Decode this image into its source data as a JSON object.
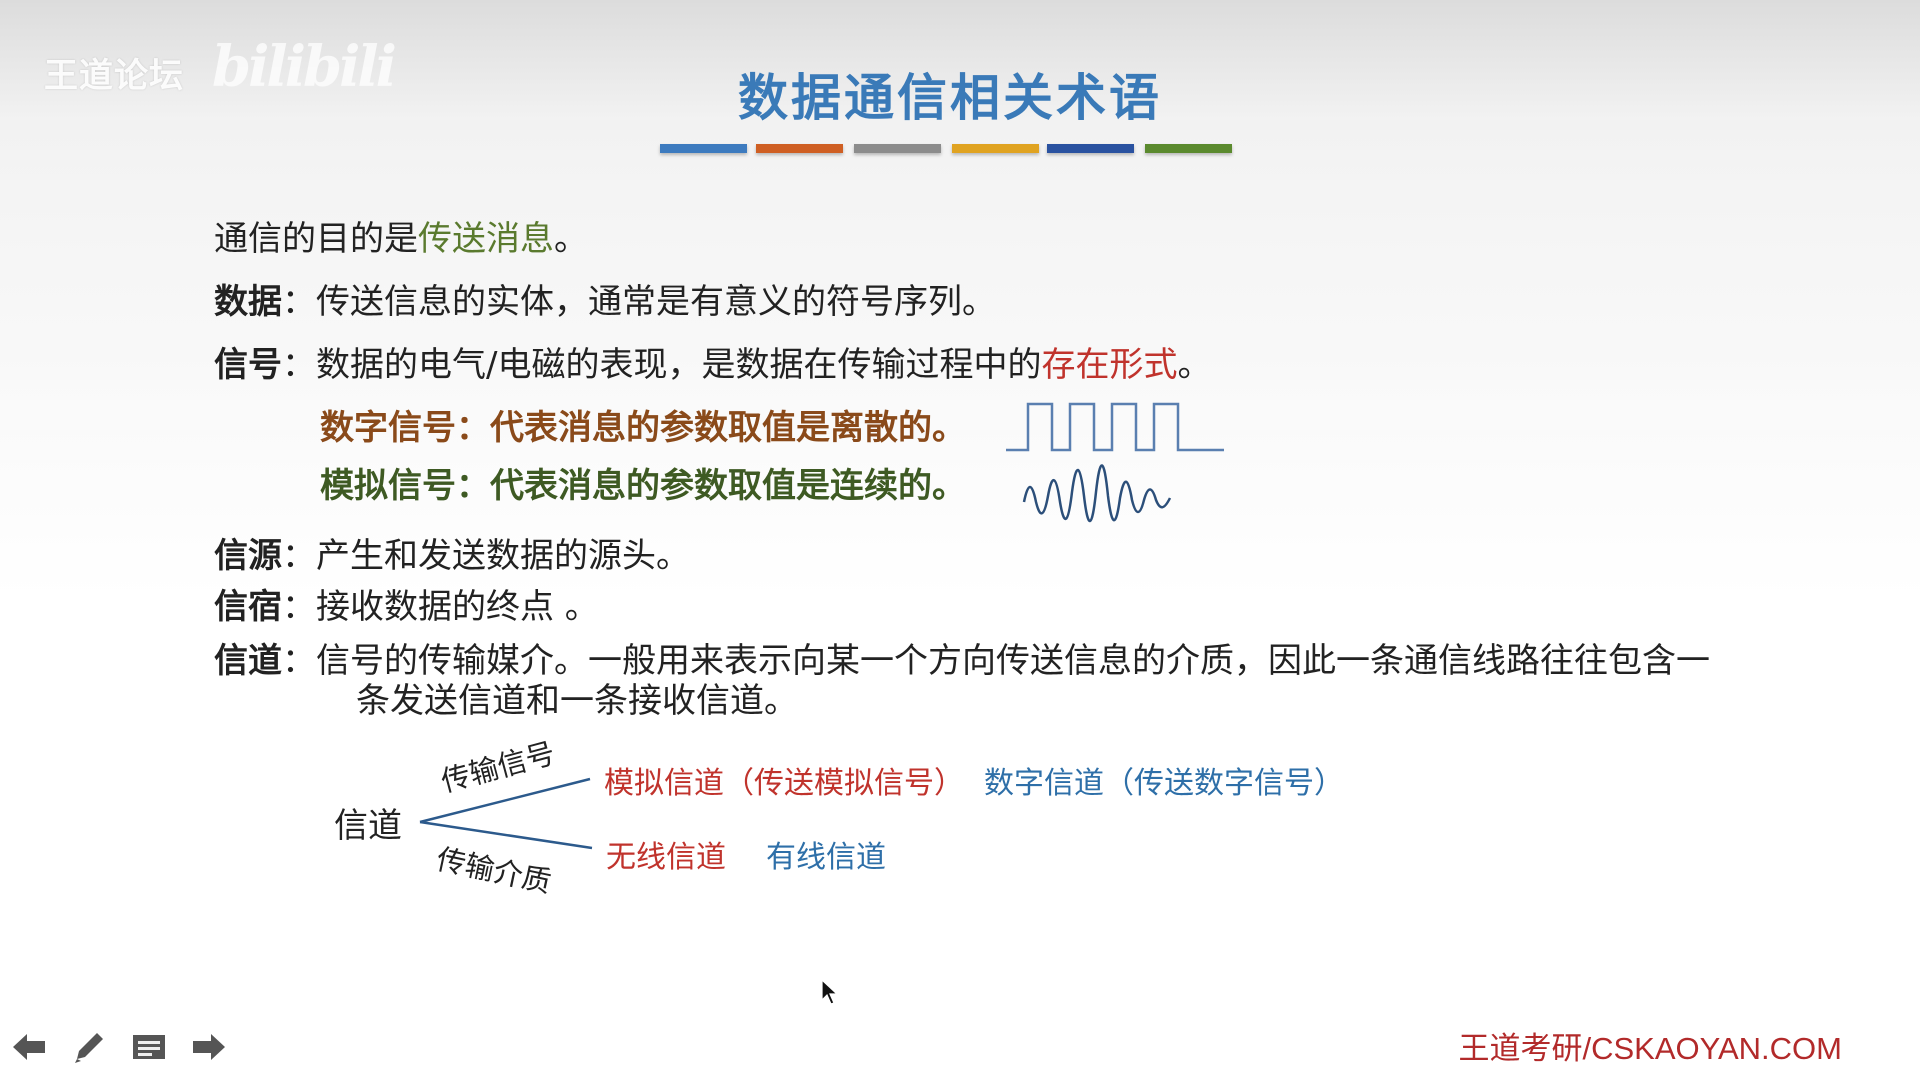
{
  "watermark": {
    "text": "王道论坛",
    "logo": "bilibili"
  },
  "title": "数据通信相关术语",
  "color_bars": [
    "#3d7bbf",
    "#cf5f23",
    "#8c8c8c",
    "#e0a321",
    "#2a52a0",
    "#5b8a2e"
  ],
  "lines": {
    "purpose": {
      "prefix": "通信的目的是",
      "highlight": "传送消息",
      "suffix": "。"
    },
    "data": {
      "term": "数据",
      "colon": "：",
      "text": "传送信息的实体，通常是有意义的符号序列。"
    },
    "signal": {
      "term": "信号",
      "colon": "：",
      "text": "数据的电气/电磁的表现，是数据在传输过程中的",
      "highlight": "存在形式",
      "suffix": "。"
    },
    "digital": "数字信号：代表消息的参数取值是离散的。",
    "analog": "模拟信号：代表消息的参数取值是连续的。",
    "source": {
      "term": "信源",
      "colon": "：",
      "text": "产生和发送数据的源头。"
    },
    "sink": {
      "term": "信宿",
      "colon": "：",
      "text": "接收数据的终点 。"
    },
    "channel": {
      "term": "信道",
      "colon": "：",
      "text": "信号的传输媒介。一般用来表示向某一个方向传送信息的介质，因此一条通信线路往往包含一",
      "text2": "条发送信道和一条接收信道。"
    }
  },
  "tree": {
    "root": "信道",
    "branch_top": "传输信号",
    "branch_bottom": "传输介质",
    "top_red": "模拟信道（传送模拟信号）",
    "top_blue": "数字信道（传送数字信号）",
    "bottom_red": "无线信道",
    "bottom_blue": "有线信道"
  },
  "nav": [
    "prev-arrow-icon",
    "pen-icon",
    "menu-icon",
    "next-arrow-icon"
  ],
  "footer": "王道考研/CSKAOYAN.COM"
}
